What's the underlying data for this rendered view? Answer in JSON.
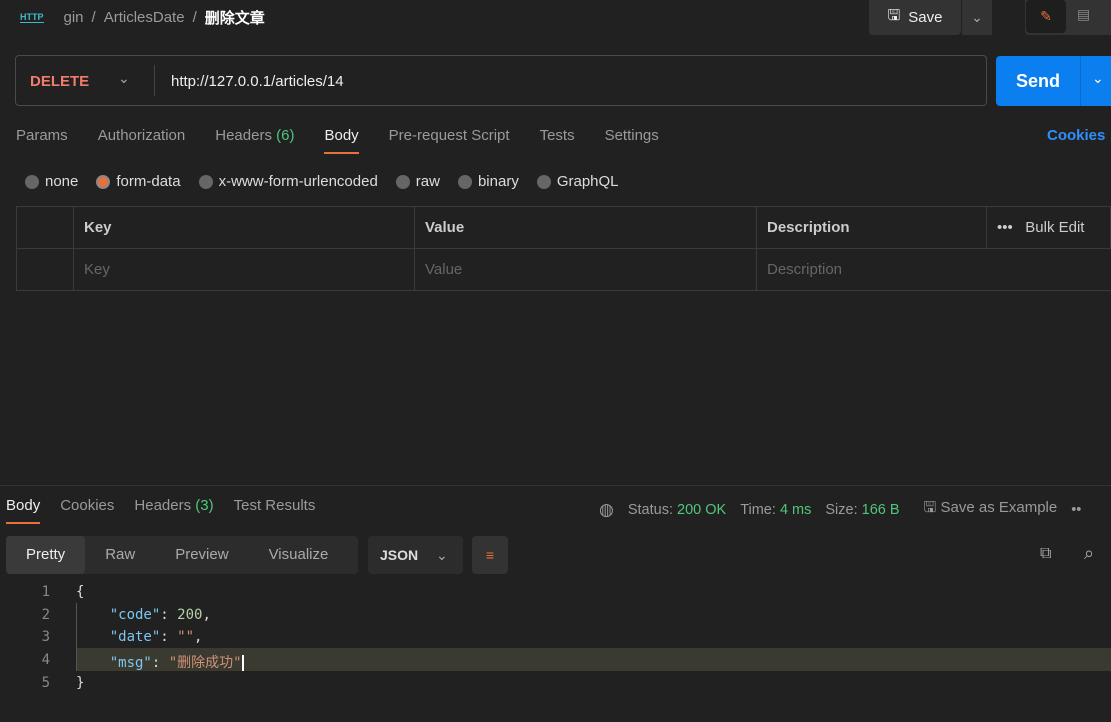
{
  "breadcrumb": {
    "icon": "HTTP",
    "items": [
      "gin",
      "ArticlesDate"
    ],
    "current": "删除文章"
  },
  "toolbar": {
    "save_label": "Save"
  },
  "request": {
    "method": "DELETE",
    "url": "http://127.0.0.1/articles/14",
    "send_label": "Send"
  },
  "tabs": [
    {
      "label": "Params"
    },
    {
      "label": "Authorization"
    },
    {
      "label": "Headers",
      "count": "(6)"
    },
    {
      "label": "Body",
      "active": true
    },
    {
      "label": "Pre-request Script"
    },
    {
      "label": "Tests"
    },
    {
      "label": "Settings"
    }
  ],
  "cookies_label": "Cookies",
  "body_types": [
    {
      "label": "none"
    },
    {
      "label": "form-data",
      "selected": true
    },
    {
      "label": "x-www-form-urlencoded"
    },
    {
      "label": "raw"
    },
    {
      "label": "binary"
    },
    {
      "label": "GraphQL"
    }
  ],
  "table": {
    "headers": [
      "Key",
      "Value",
      "Description"
    ],
    "bulk_edit": "Bulk Edit",
    "placeholders": [
      "Key",
      "Value",
      "Description"
    ]
  },
  "response": {
    "tabs": [
      {
        "label": "Body"
      },
      {
        "label": "Cookies"
      },
      {
        "label": "Headers",
        "count": "(3)"
      },
      {
        "label": "Test Results"
      }
    ],
    "status_label": "Status:",
    "status": "200 OK",
    "time_label": "Time:",
    "time": "4 ms",
    "size_label": "Size:",
    "size": "166 B",
    "save_example": "Save as Example",
    "formats": [
      "Pretty",
      "Raw",
      "Preview",
      "Visualize"
    ],
    "language": "JSON",
    "lines": [
      "1",
      "2",
      "3",
      "4",
      "5"
    ]
  },
  "colors": {
    "accent": "#e8703a",
    "send": "#0b7ef0",
    "method": "#f07d6c",
    "success": "#4fc77a"
  }
}
